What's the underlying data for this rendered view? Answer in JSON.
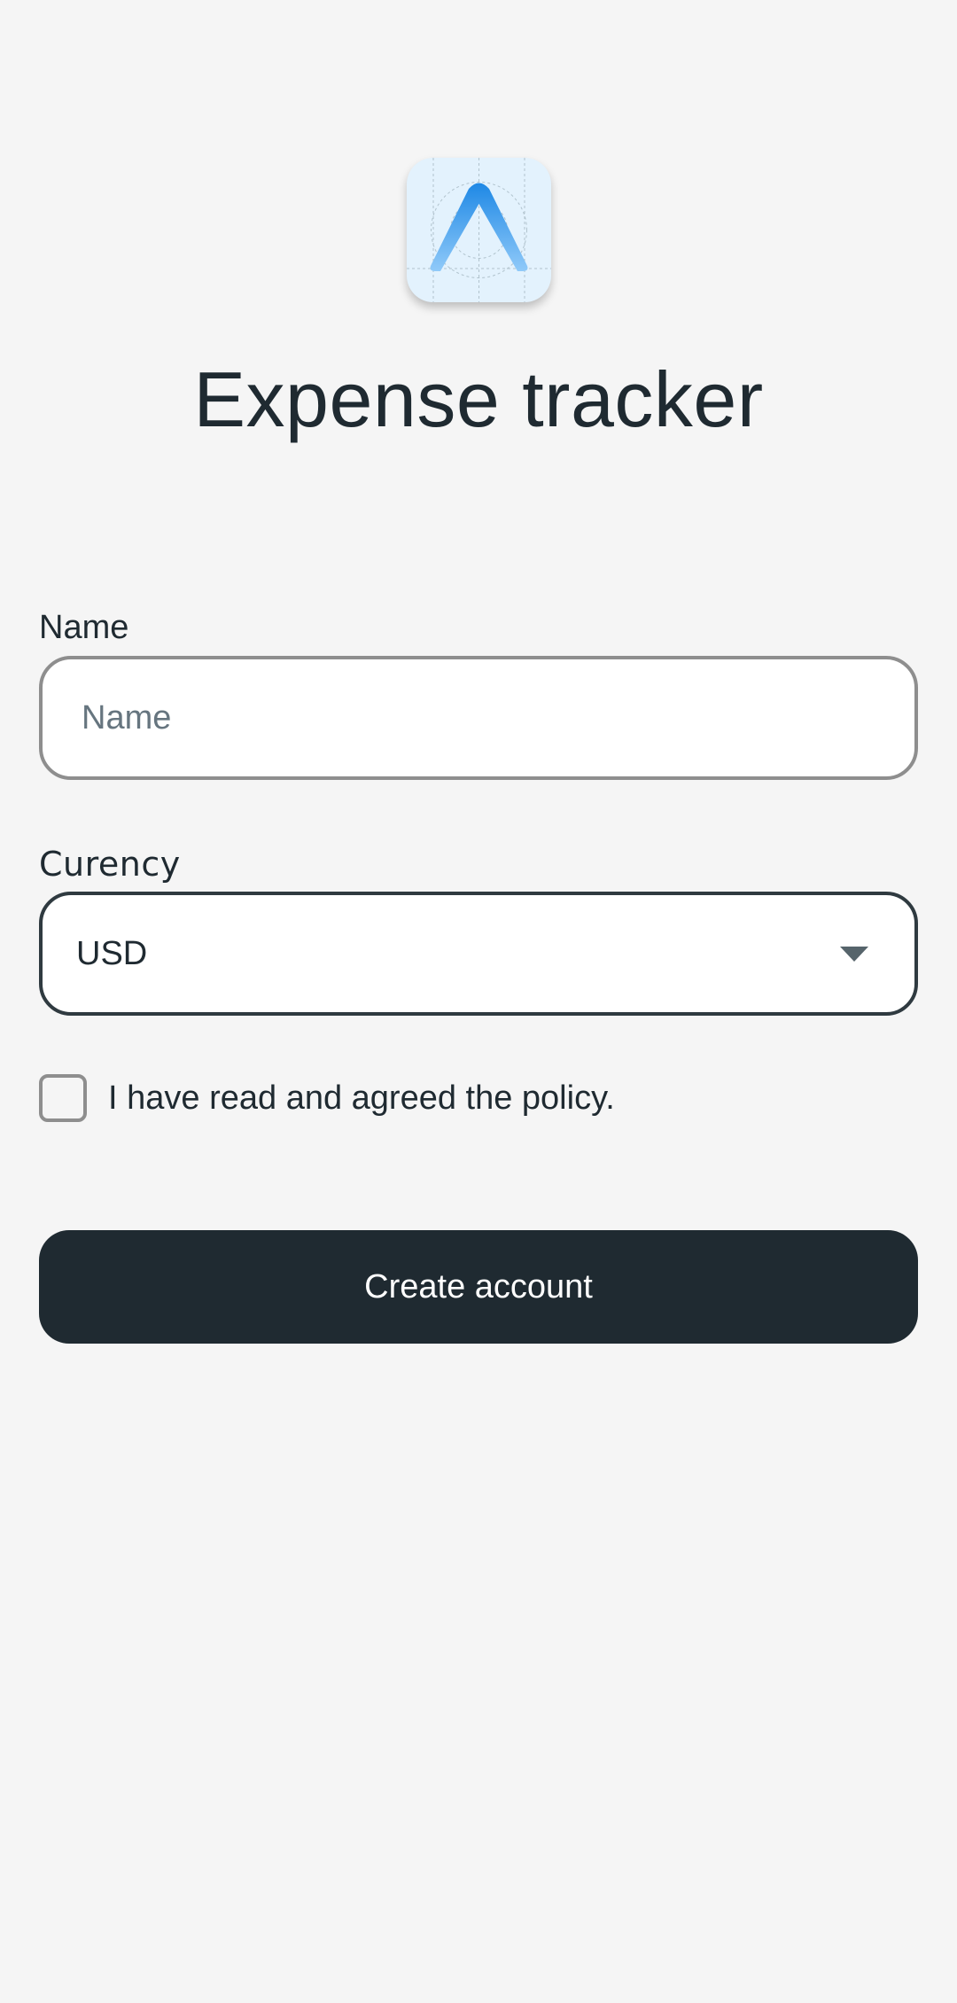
{
  "app": {
    "logo_icon": "flutter-style-logo-icon",
    "title": "Expense tracker"
  },
  "form": {
    "name": {
      "label": "Name",
      "placeholder": "Name",
      "value": ""
    },
    "currency": {
      "label": "Curency",
      "selected": "USD",
      "dropdown_icon": "caret-down-icon"
    },
    "policy": {
      "checked": false,
      "label": "I have read and agreed the policy."
    },
    "submit_label": "Create account"
  },
  "colors": {
    "background": "#f5f5f5",
    "primary": "#1f2a31",
    "icon_background": "#e3f2fd",
    "logo_blue": "#2196f3"
  }
}
